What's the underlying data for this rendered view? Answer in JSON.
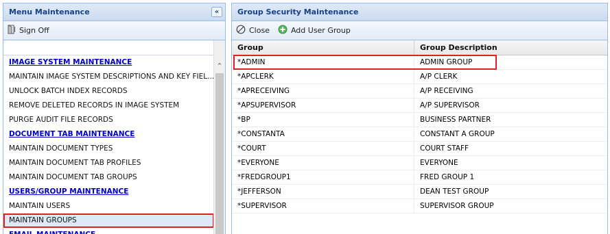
{
  "left_panel": {
    "title": "Menu Maintenance",
    "collapse_glyph": "«",
    "toolbar": {
      "sign_off_label": "Sign Off",
      "sign_off_icon": "door-icon"
    },
    "items": [
      {
        "label": "IMAGE SYSTEM MAINTENANCE",
        "type": "section"
      },
      {
        "label": "MAINTAIN IMAGE SYSTEM DESCRIPTIONS AND KEY FIEL...",
        "type": "item"
      },
      {
        "label": "UNLOCK BATCH INDEX RECORDS",
        "type": "item"
      },
      {
        "label": "REMOVE DELETED RECORDS IN IMAGE SYSTEM",
        "type": "item"
      },
      {
        "label": "PURGE AUDIT FILE RECORDS",
        "type": "item"
      },
      {
        "label": "DOCUMENT TAB MAINTENANCE",
        "type": "section"
      },
      {
        "label": "MAINTAIN DOCUMENT TYPES",
        "type": "item"
      },
      {
        "label": "MAINTAIN DOCUMENT TAB PROFILES",
        "type": "item"
      },
      {
        "label": "MAINTAIN DOCUMENT TAB GROUPS",
        "type": "item"
      },
      {
        "label": "USERS/GROUP MAINTENANCE",
        "type": "section"
      },
      {
        "label": "MAINTAIN USERS",
        "type": "item"
      },
      {
        "label": "MAINTAIN GROUPS",
        "type": "selected"
      },
      {
        "label": "EMAIL MAINTENANCE",
        "type": "clipped"
      }
    ]
  },
  "right_panel": {
    "title": "Group Security Maintenance",
    "toolbar": {
      "close_label": "Close",
      "add_label": "Add User Group"
    },
    "columns": [
      "Group",
      "Group Description"
    ],
    "rows": [
      [
        "*ADMIN",
        "ADMIN GROUP"
      ],
      [
        "*APCLERK",
        "A/P CLERK"
      ],
      [
        "*APRECEIVING",
        "A/P RECEIVING"
      ],
      [
        "*APSUPERVISOR",
        "A/P SUPERVISOR"
      ],
      [
        "*BP",
        "BUSINESS PARTNER"
      ],
      [
        "*CONSTANTA",
        "CONSTANT A GROUP"
      ],
      [
        "*COURT",
        "COURT STAFF"
      ],
      [
        "*EVERYONE",
        "EVERYONE"
      ],
      [
        "*FREDGROUP1",
        "FRED GROUP 1"
      ],
      [
        "*JEFFERSON",
        "DEAN TEST GROUP"
      ],
      [
        "*SUPERVISOR",
        "SUPERVISOR GROUP"
      ]
    ]
  },
  "colors": {
    "header_text": "#15428b",
    "section_link": "#0000cc",
    "highlight_border": "#e02020",
    "panel_border": "#99bbe8"
  }
}
